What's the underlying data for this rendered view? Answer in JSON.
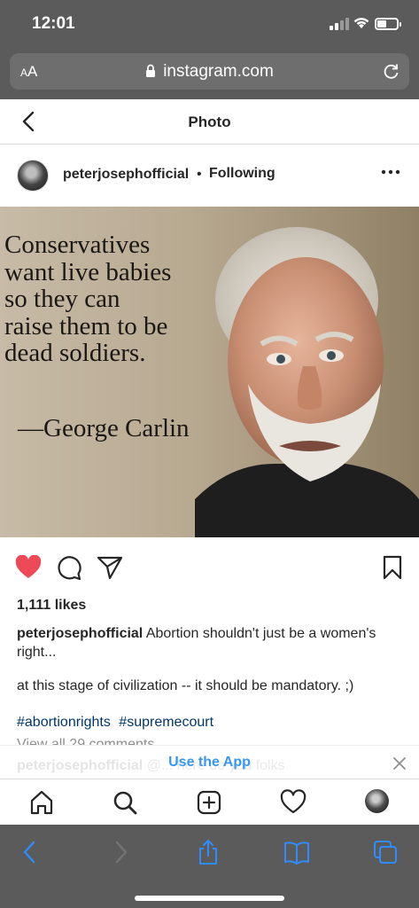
{
  "status_bar": {
    "time": "12:01"
  },
  "browser": {
    "text_size_label": "AA",
    "url": "instagram.com"
  },
  "header": {
    "title": "Photo"
  },
  "post": {
    "username": "peterjosephofficial",
    "separator": "•",
    "follow_status": "Following",
    "image": {
      "quote": "Conservatives\nwant live babies\nso they can\nraise them to be\ndead soldiers.",
      "author": "—George Carlin"
    },
    "liked": true,
    "likes": "1,111 likes",
    "caption_username": "peterjosephofficial",
    "caption_text": "Abortion shouldn't just be a women's right...",
    "caption_line2": "at this stage of civilization -- it should be mandatory. ;)",
    "hashtags": [
      "#abortionrights",
      "#supremecourt"
    ],
    "view_all": "View all 29 comments"
  },
  "banner": {
    "label": "Use the App",
    "behind_comment_user": "peterjosephofficial",
    "behind_comment_text": "@... here do you folks"
  },
  "icons": {
    "back": "chevron-left-icon",
    "more": "more-horizontal-icon",
    "like": "heart-icon",
    "comment": "comment-icon",
    "share": "send-icon",
    "save": "bookmark-icon",
    "home": "home-icon",
    "search": "search-icon",
    "new_post": "plus-square-icon",
    "activity": "heart-outline-icon",
    "safari_back": "chevron-left-icon",
    "safari_forward": "chevron-right-icon",
    "safari_share": "share-icon",
    "safari_bookmarks": "book-icon",
    "safari_tabs": "tabs-icon"
  },
  "colors": {
    "like_red": "#ed4956",
    "link_blue": "#3897f0",
    "hashtag": "#00376b",
    "browser_chrome": "#5b5b5b",
    "safari_tint": "#2f8cff"
  }
}
